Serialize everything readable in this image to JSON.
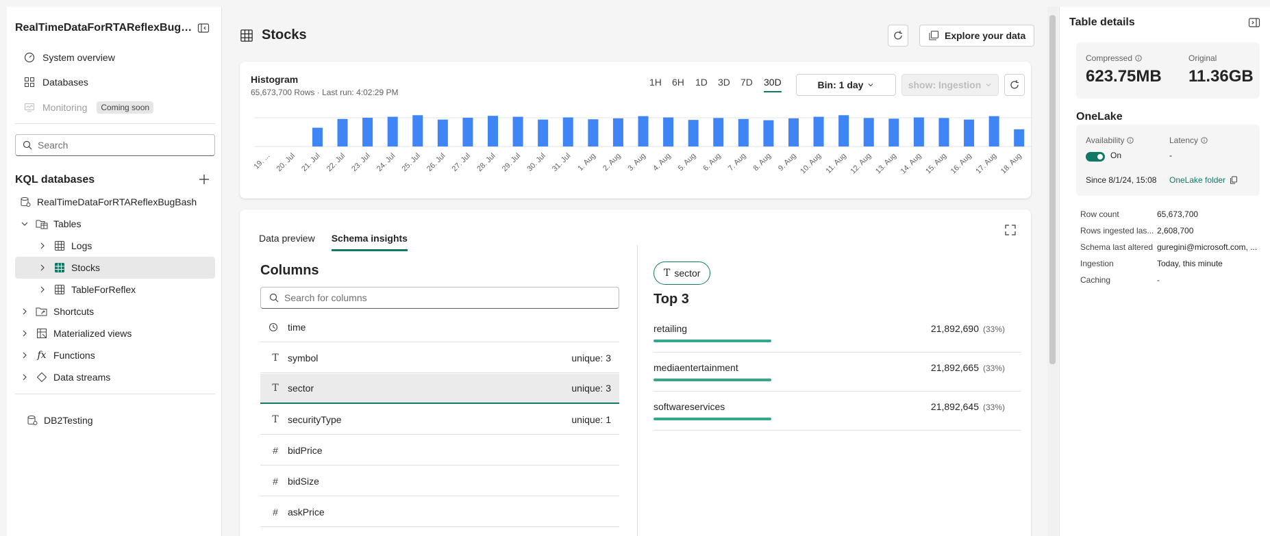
{
  "sidebar": {
    "title": "RealTimeDataForRTAReflexBugBash",
    "nav": [
      {
        "label": "System overview",
        "icon": "gauge-icon"
      },
      {
        "label": "Databases",
        "icon": "grid-icon"
      },
      {
        "label": "Monitoring",
        "icon": "monitor-icon",
        "badge": "Coming soon"
      }
    ],
    "search_placeholder": "Search",
    "kql_heading": "KQL databases",
    "tree": {
      "db1": "RealTimeDataForRTAReflexBugBash",
      "tables": "Tables",
      "logs": "Logs",
      "stocks": "Stocks",
      "tableforreflex": "TableForReflex",
      "shortcuts": "Shortcuts",
      "materialized": "Materialized views",
      "functions": "Functions",
      "datastreams": "Data streams",
      "db2": "DB2Testing"
    }
  },
  "header": {
    "title": "Stocks",
    "explore_label": "Explore your data"
  },
  "histogram": {
    "title": "Histogram",
    "subtitle": "65,673,700 Rows · Last run: 4:02:29 PM",
    "ranges": [
      "1H",
      "6H",
      "1D",
      "3D",
      "7D",
      "30D"
    ],
    "active_range": "30D",
    "bin_label": "Bin: 1 day",
    "show_label": "show: Ingestion"
  },
  "chart_data": {
    "type": "bar",
    "categories": [
      "19. ...",
      "20. Jul",
      "21. Jul",
      "22. Jul",
      "23. Jul",
      "24. Jul",
      "25. Jul",
      "26. Jul",
      "27. Jul",
      "28. Jul",
      "29. Jul",
      "30. Jul",
      "31. Jul",
      "1. Aug",
      "2. Aug",
      "3. Aug",
      "4. Aug",
      "5. Aug",
      "6. Aug",
      "7. Aug",
      "8. Aug",
      "9. Aug",
      "10. Aug",
      "11. Aug",
      "12. Aug",
      "13. Aug",
      "14. Aug",
      "15. Aug",
      "16. Aug",
      "17. Aug",
      "18. Aug"
    ],
    "values": [
      0,
      0,
      0.6,
      0.88,
      0.92,
      0.95,
      1.0,
      0.86,
      0.92,
      0.98,
      0.95,
      0.86,
      0.93,
      0.87,
      0.9,
      0.97,
      0.93,
      0.85,
      0.91,
      0.88,
      0.84,
      0.9,
      0.95,
      1.0,
      0.91,
      0.89,
      0.93,
      0.91,
      0.86,
      0.97,
      0.55
    ],
    "ylim": [
      0,
      1.05
    ],
    "grid": true,
    "color": "#3f85f5"
  },
  "details": {
    "tabs": [
      "Data preview",
      "Schema insights"
    ],
    "active_tab": "Schema insights",
    "columns_heading": "Columns",
    "columns_search_placeholder": "Search for columns",
    "columns": [
      {
        "name": "time",
        "icon": "clock-icon",
        "unique": ""
      },
      {
        "name": "symbol",
        "icon": "text-type-icon",
        "unique": "unique: 3"
      },
      {
        "name": "sector",
        "icon": "text-type-icon",
        "unique": "unique: 3"
      },
      {
        "name": "securityType",
        "icon": "text-type-icon",
        "unique": "unique: 1"
      },
      {
        "name": "bidPrice",
        "icon": "number-type-icon",
        "unique": ""
      },
      {
        "name": "bidSize",
        "icon": "number-type-icon",
        "unique": ""
      },
      {
        "name": "askPrice",
        "icon": "number-type-icon",
        "unique": ""
      }
    ],
    "selected_column": "sector",
    "top_heading": "Top 3",
    "top": [
      {
        "name": "retailing",
        "value": "21,892,690",
        "pct": "(33%)",
        "fraction": 0.33
      },
      {
        "name": "mediaentertainment",
        "value": "21,892,665",
        "pct": "(33%)",
        "fraction": 0.33
      },
      {
        "name": "softwareservices",
        "value": "21,892,645",
        "pct": "(33%)",
        "fraction": 0.33
      }
    ]
  },
  "table_details": {
    "title": "Table details",
    "compressed_label": "Compressed",
    "compressed_value": "623.75MB",
    "original_label": "Original",
    "original_value": "11.36GB",
    "onelake_heading": "OneLake",
    "availability_label": "Availability",
    "availability_value": "On",
    "latency_label": "Latency",
    "latency_value": "-",
    "since": "Since 8/1/24, 15:08",
    "onelake_folder": "OneLake folder",
    "props": [
      {
        "k": "Row count",
        "v": "65,673,700"
      },
      {
        "k": "Rows ingested las...",
        "v": "2,608,700"
      },
      {
        "k": "Schema last altered",
        "v": "guregini@microsoft.com, ..."
      },
      {
        "k": "Ingestion",
        "v": "Today, this minute"
      },
      {
        "k": "Caching",
        "v": "-"
      }
    ]
  }
}
